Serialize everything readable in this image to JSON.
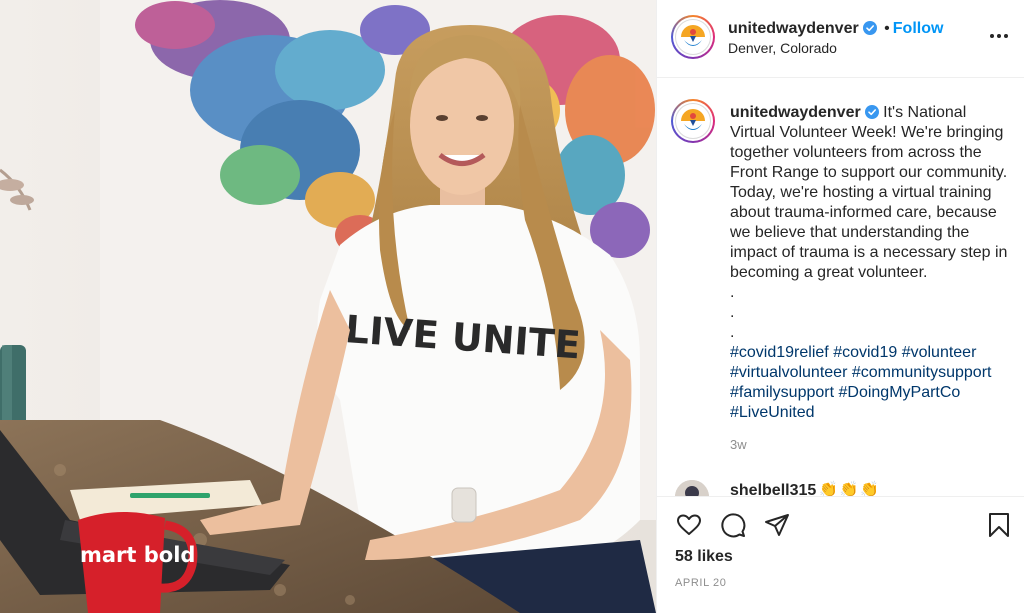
{
  "post": {
    "author": {
      "username": "unitedwaydenver",
      "verified": true,
      "location": "Denver, Colorado"
    },
    "follow_label": "Follow",
    "separator": "•",
    "image": {
      "mug_text": "mart bold",
      "shirt_text": "LIVE UNITE"
    },
    "caption": {
      "username": "unitedwaydenver",
      "text": "It's National Virtual Volunteer Week! We're bringing together volunteers from across the Front Range to support our community. Today, we're hosting a virtual training about trauma-informed care, because we believe that understanding the impact of trauma is a necessary step in becoming a great volunteer.",
      "dots": [
        ".",
        ".",
        "."
      ],
      "hashtags": [
        "#covid19relief",
        "#covid19",
        "#volunteer",
        "#virtualvolunteer",
        "#communitysupport",
        "#familysupport",
        "#DoingMyPartCo",
        "#LiveUnited"
      ]
    },
    "time_ago": "3w",
    "comment": {
      "username": "shelbell315",
      "text": "👏👏👏"
    },
    "likes": "58 likes",
    "date": "APRIL 20"
  },
  "colors": {
    "follow": "#0095f6",
    "hashtag": "#00376b",
    "verified": "#3897f0",
    "muted": "#8e8e8e",
    "mug": "#d6202a"
  },
  "icons": [
    "verified-badge-icon",
    "more-options-icon",
    "heart-icon",
    "comment-bubble-icon",
    "paper-plane-icon",
    "bookmark-icon"
  ]
}
